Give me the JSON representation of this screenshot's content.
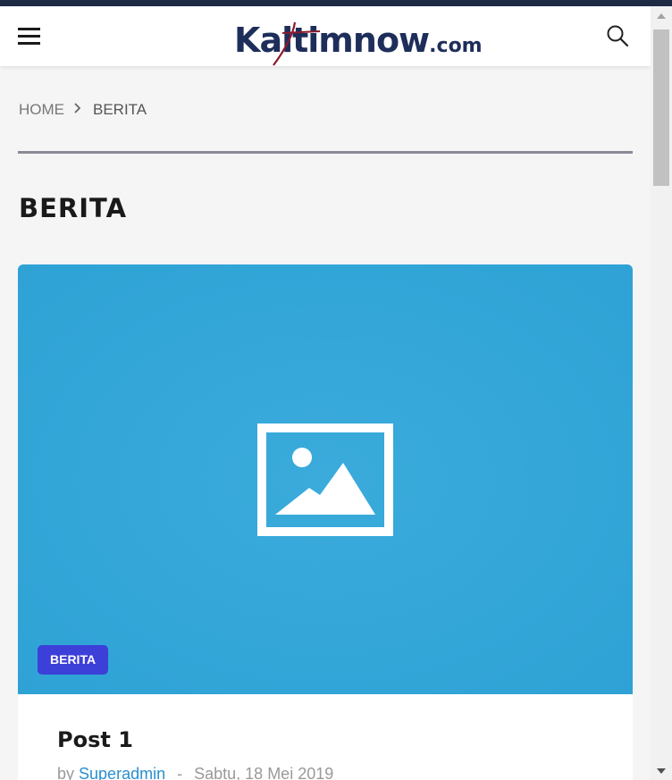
{
  "header": {
    "logo_main": "Kaltimnow",
    "logo_suffix": ".com",
    "colors": {
      "logo_text": "#1e2e5a",
      "logo_accent": "#8b1a2b",
      "top_strip": "#1c2a44"
    }
  },
  "breadcrumb": {
    "home": "HOME",
    "separator_icon": "chevron-right-icon",
    "current": "BERITA"
  },
  "page": {
    "title": "BERITA"
  },
  "post": {
    "category": "BERITA",
    "title": "Post 1",
    "by_label": "by",
    "author": "Superadmin",
    "separator": "-",
    "date": "Sabtu, 18 Mei 2019",
    "image_icon": "image-placeholder-icon",
    "colors": {
      "image_bg": "#34a7d9",
      "badge": "#3d3fd9",
      "author_link": "#2a8fd0"
    }
  }
}
